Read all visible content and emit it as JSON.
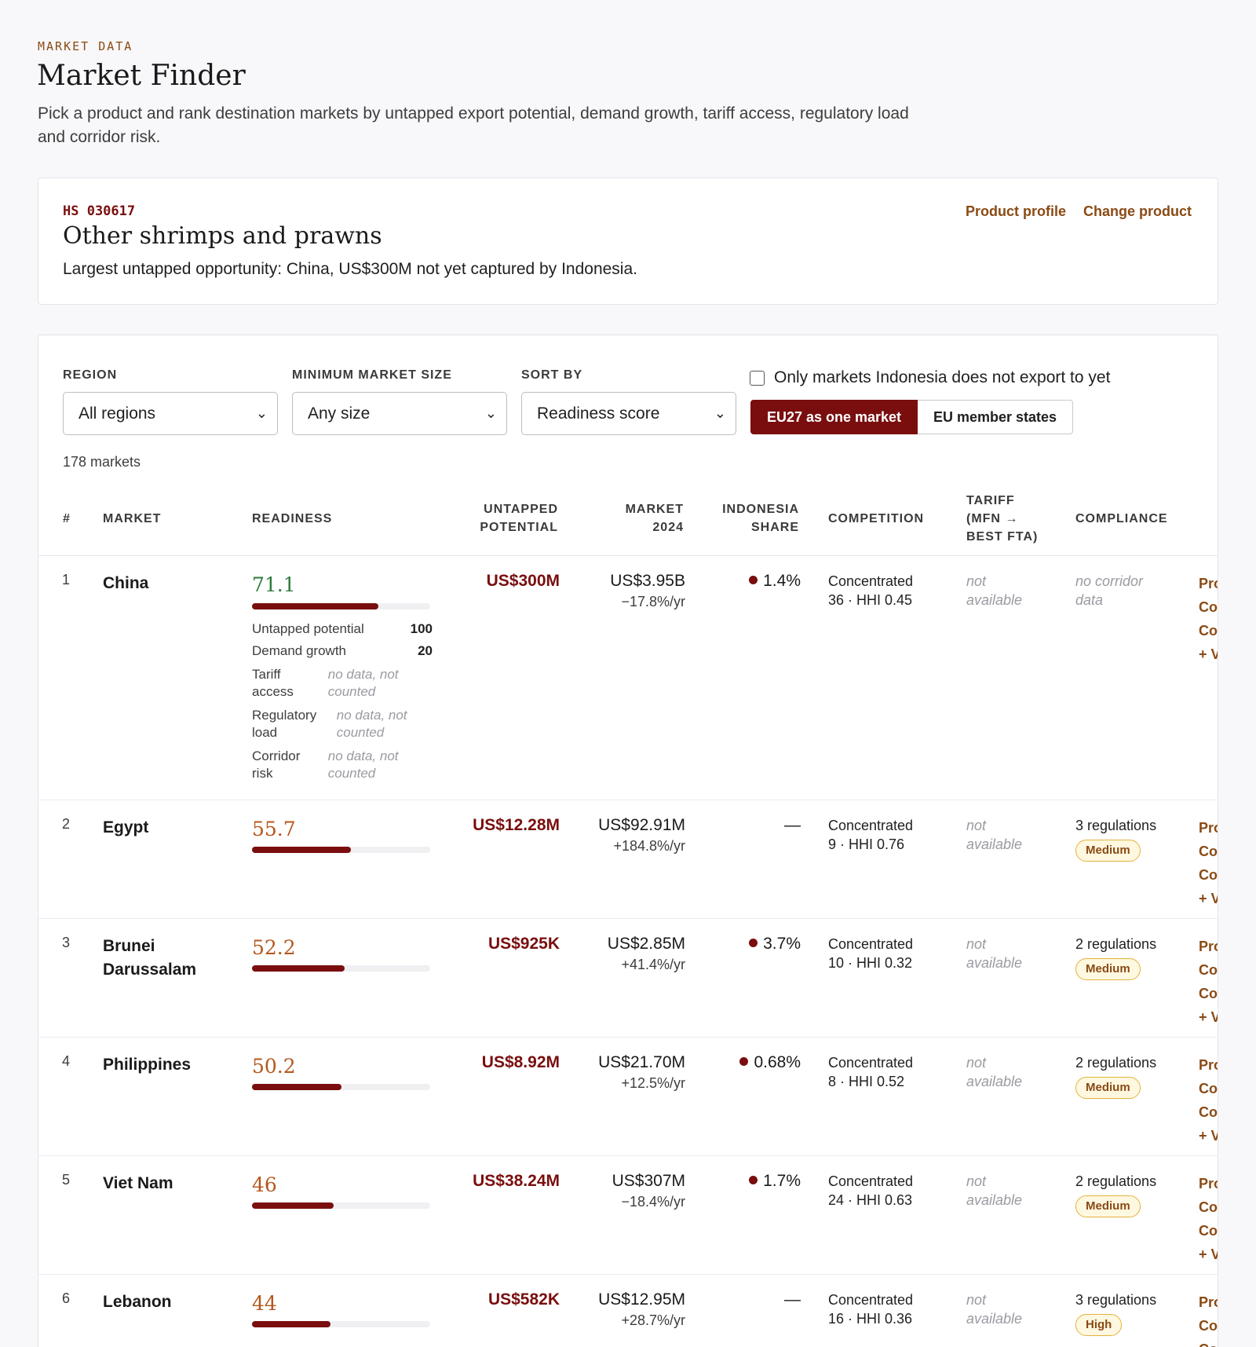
{
  "header": {
    "eyebrow": "MARKET DATA",
    "title": "Market Finder",
    "description": "Pick a product and rank destination markets by untapped export potential, demand growth, tariff access, regulatory load and corridor risk."
  },
  "product": {
    "hs_code": "HS 030617",
    "name": "Other shrimps and prawns",
    "insight": "Largest untapped opportunity: China, US$300M not yet captured by Indonesia.",
    "profile_link": "Product profile",
    "change_link": "Change product"
  },
  "filters": {
    "region_label": "REGION",
    "region_value": "All regions",
    "size_label": "MINIMUM MARKET SIZE",
    "size_value": "Any size",
    "sort_label": "SORT BY",
    "sort_value": "Readiness score",
    "only_new_label": "Only markets Indonesia does not export to yet",
    "only_new_checked": false,
    "eu_one": "EU27 as one market",
    "eu_members": "EU member states",
    "eu_mode_selected": "EU27 as one market"
  },
  "count": "178 markets",
  "columns": {
    "rank": "#",
    "market": "MARKET",
    "readiness": "READINESS",
    "untapped_1": "UNTAPPED",
    "untapped_2": "POTENTIAL",
    "market_1": "MARKET",
    "market_2": "2024",
    "share_1": "INDONESIA",
    "share_2": "SHARE",
    "competition": "COMPETITION",
    "tariff_1": "TARIFF",
    "tariff_2": "(MFN →",
    "tariff_3": "BEST FTA)",
    "compliance": "COMPLIANCE"
  },
  "rows": [
    {
      "rank": "1",
      "market": "China",
      "score": "71.1",
      "score_pct": 71.1,
      "untapped": "US$300M",
      "market_value": "US$3.95B",
      "growth": "−17.8%/yr",
      "share": "1.4%",
      "comp_1": "Concentrated",
      "comp_2": "36 · HHI 0.45",
      "tariff_1": "not",
      "tariff_2": "available",
      "compliance_1": "no corridor",
      "compliance_2": "data",
      "action_1": "Pro",
      "action_2": "Co",
      "action_3": "Co",
      "action_4": "+ V",
      "breakdown": {
        "untapped_label": "Untapped potential",
        "untapped_val": "100",
        "demand_label": "Demand growth",
        "demand_val": "20",
        "tariff_label_1": "Tariff",
        "tariff_label_2": "access",
        "regulatory_label_1": "Regulatory",
        "regulatory_label_2": "load",
        "corridor_label_1": "Corridor",
        "corridor_label_2": "risk",
        "na_1": "no data, not",
        "na_2": "counted"
      }
    },
    {
      "rank": "2",
      "market": "Egypt",
      "score": "55.7",
      "score_pct": 55.7,
      "untapped": "US$12.28M",
      "market_value": "US$92.91M",
      "growth": "+184.8%/yr",
      "share": "—",
      "comp_1": "Concentrated",
      "comp_2": "9 · HHI 0.76",
      "tariff_1": "not",
      "tariff_2": "available",
      "compliance_1": "3 regulations",
      "badge": "Medium",
      "action_1": "Pro",
      "action_2": "Co",
      "action_3": "Co",
      "action_4": "+ V"
    },
    {
      "rank": "3",
      "market_1": "Brunei",
      "market_2": "Darussalam",
      "score": "52.2",
      "score_pct": 52.2,
      "untapped": "US$925K",
      "market_value": "US$2.85M",
      "growth": "+41.4%/yr",
      "share": "3.7%",
      "comp_1": "Concentrated",
      "comp_2": "10 · HHI 0.32",
      "tariff_1": "not",
      "tariff_2": "available",
      "compliance_1": "2 regulations",
      "badge": "Medium",
      "action_1": "Pro",
      "action_2": "Co",
      "action_3": "Co",
      "action_4": "+ V"
    },
    {
      "rank": "4",
      "market": "Philippines",
      "score": "50.2",
      "score_pct": 50.2,
      "untapped": "US$8.92M",
      "market_value": "US$21.70M",
      "growth": "+12.5%/yr",
      "share": "0.68%",
      "comp_1": "Concentrated",
      "comp_2": "8 · HHI 0.52",
      "tariff_1": "not",
      "tariff_2": "available",
      "compliance_1": "2 regulations",
      "badge": "Medium",
      "action_1": "Pro",
      "action_2": "Co",
      "action_3": "Co",
      "action_4": "+ V"
    },
    {
      "rank": "5",
      "market": "Viet Nam",
      "score": "46",
      "score_pct": 46,
      "untapped": "US$38.24M",
      "market_value": "US$307M",
      "growth": "−18.4%/yr",
      "share": "1.7%",
      "comp_1": "Concentrated",
      "comp_2": "24 · HHI 0.63",
      "tariff_1": "not",
      "tariff_2": "available",
      "compliance_1": "2 regulations",
      "badge": "Medium",
      "action_1": "Pro",
      "action_2": "Co",
      "action_3": "Co",
      "action_4": "+ V"
    },
    {
      "rank": "6",
      "market": "Lebanon",
      "score": "44",
      "score_pct": 44,
      "untapped": "US$582K",
      "market_value": "US$12.95M",
      "growth": "+28.7%/yr",
      "share": "—",
      "comp_1": "Concentrated",
      "comp_2": "16 · HHI 0.36",
      "tariff_1": "not",
      "tariff_2": "available",
      "compliance_1": "3 regulations",
      "badge": "High",
      "action_1": "Pro",
      "action_2": "Co",
      "action_3": "Co"
    }
  ],
  "colors": {
    "accent": "#7a0e0e",
    "link": "#8a4a14",
    "score_high": "#2e7a3c",
    "score_mid": "#b4571b",
    "badge_border": "#e2b33a"
  }
}
